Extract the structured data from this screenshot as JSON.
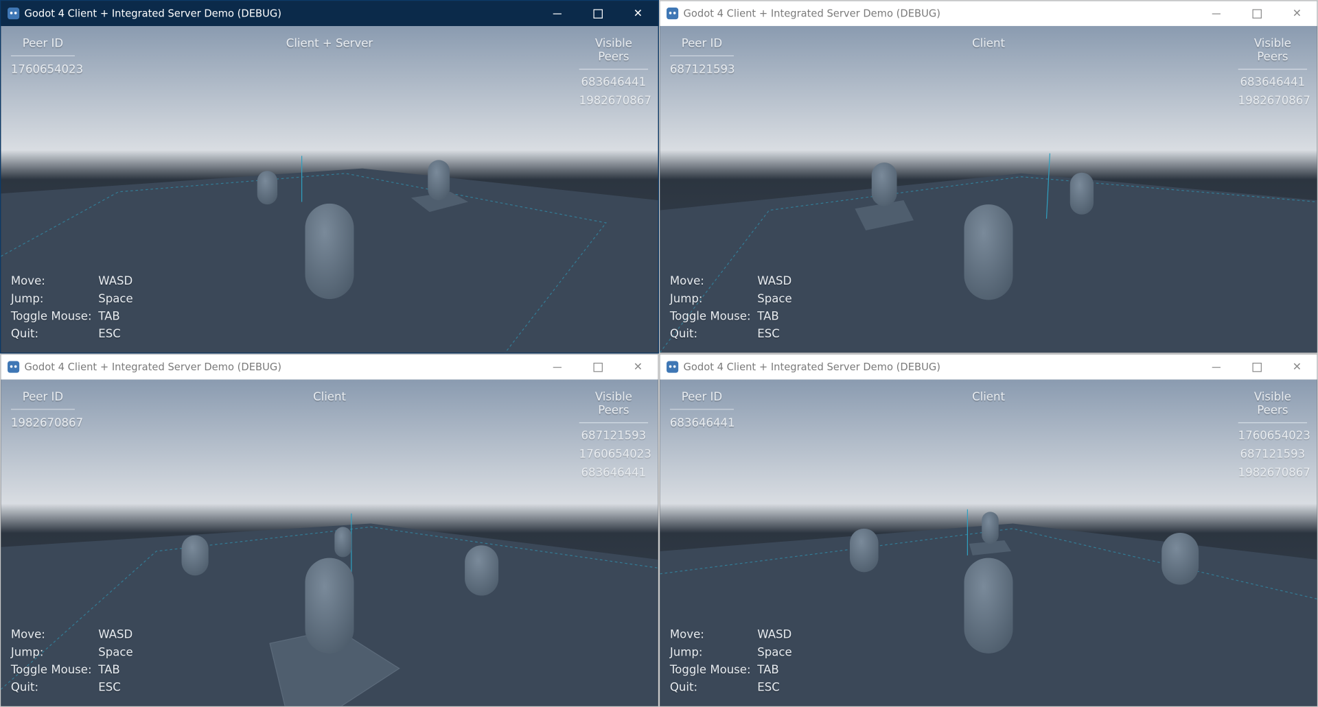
{
  "windows": [
    {
      "title": "Godot 4 Client + Integrated Server Demo (DEBUG)",
      "active": true,
      "hud": {
        "peer_id_header": "Peer ID",
        "peer_id": "1760654023",
        "mode": "Client + Server",
        "visible_peers_header": "Visible Peers",
        "visible_peers": [
          "683646441",
          "1982670867"
        ]
      }
    },
    {
      "title": "Godot 4 Client + Integrated Server Demo (DEBUG)",
      "active": false,
      "hud": {
        "peer_id_header": "Peer ID",
        "peer_id": "687121593",
        "mode": "Client",
        "visible_peers_header": "Visible Peers",
        "visible_peers": [
          "683646441",
          "1982670867"
        ]
      }
    },
    {
      "title": "Godot 4 Client + Integrated Server Demo (DEBUG)",
      "active": false,
      "hud": {
        "peer_id_header": "Peer ID",
        "peer_id": "1982670867",
        "mode": "Client",
        "visible_peers_header": "Visible Peers",
        "visible_peers": [
          "687121593",
          "1760654023",
          "683646441"
        ]
      }
    },
    {
      "title": "Godot 4 Client + Integrated Server Demo (DEBUG)",
      "active": false,
      "hud": {
        "peer_id_header": "Peer ID",
        "peer_id": "683646441",
        "mode": "Client",
        "visible_peers_header": "Visible Peers",
        "visible_peers": [
          "1760654023",
          "687121593",
          "1982670867"
        ]
      }
    }
  ],
  "controls": [
    {
      "label": "Move:",
      "key": "WASD"
    },
    {
      "label": "Jump:",
      "key": "Space"
    },
    {
      "label": "Toggle Mouse:",
      "key": "TAB"
    },
    {
      "label": "Quit:",
      "key": "ESC"
    }
  ],
  "colors": {
    "sky_top": "#8a9bb0",
    "sky_horizon": "#d9dde2",
    "ground": "#3b4858",
    "ground_edge": "#232b35",
    "capsule": "#5f7082",
    "grid_line": "#2fa0c0",
    "active_titlebar": "#0b2a4a"
  },
  "icons": {
    "app": "godot-icon",
    "minimize": "minimize-icon",
    "maximize": "maximize-icon",
    "close": "close-icon"
  }
}
